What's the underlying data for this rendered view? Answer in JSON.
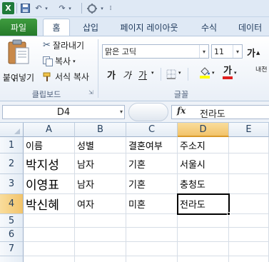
{
  "quick_access": {
    "app_icon": "X",
    "undo_icon": "↶",
    "redo_icon": "↷"
  },
  "tabs": [
    {
      "label": "파일"
    },
    {
      "label": "홈"
    },
    {
      "label": "삽입"
    },
    {
      "label": "페이지 레이아웃"
    },
    {
      "label": "수식"
    },
    {
      "label": "데이터"
    }
  ],
  "ribbon": {
    "clipboard": {
      "paste_label": "붙여넣기",
      "cut_label": "잘라내기",
      "copy_label": "복사",
      "format_painter_label": "서식 복사",
      "group_label": "클립보드"
    },
    "font": {
      "font_name": "맑은 고딕",
      "font_size": "11",
      "grow_font": "가",
      "bold": "가",
      "italic": "가",
      "underline": "가",
      "font_color": "가",
      "group_label": "글꼴",
      "phonetic_label": "내천"
    }
  },
  "formula_bar": {
    "name_box": "D4",
    "fx_label": "fx",
    "value": "전라도"
  },
  "sheet": {
    "columns": [
      "A",
      "B",
      "C",
      "D",
      "E"
    ],
    "rows": [
      "1",
      "2",
      "3",
      "4",
      "5",
      "6",
      "7"
    ],
    "cells": [
      [
        "이름",
        "성별",
        "결혼여부",
        "주소지",
        ""
      ],
      [
        "박지성",
        "남자",
        "기혼",
        "서울시",
        ""
      ],
      [
        "이영표",
        "남자",
        "기혼",
        "충청도",
        ""
      ],
      [
        "박신혜",
        "여자",
        "미혼",
        "전라도",
        ""
      ],
      [
        "",
        "",
        "",
        "",
        ""
      ],
      [
        "",
        "",
        "",
        "",
        ""
      ],
      [
        "",
        "",
        "",
        "",
        ""
      ]
    ],
    "active_cell": "D4"
  },
  "colors": {
    "file_tab": "#2f8a33",
    "selected_header": "#f5cd7c",
    "font_color_bar": "#e02020",
    "fill_color_bar": "#ffff00"
  }
}
